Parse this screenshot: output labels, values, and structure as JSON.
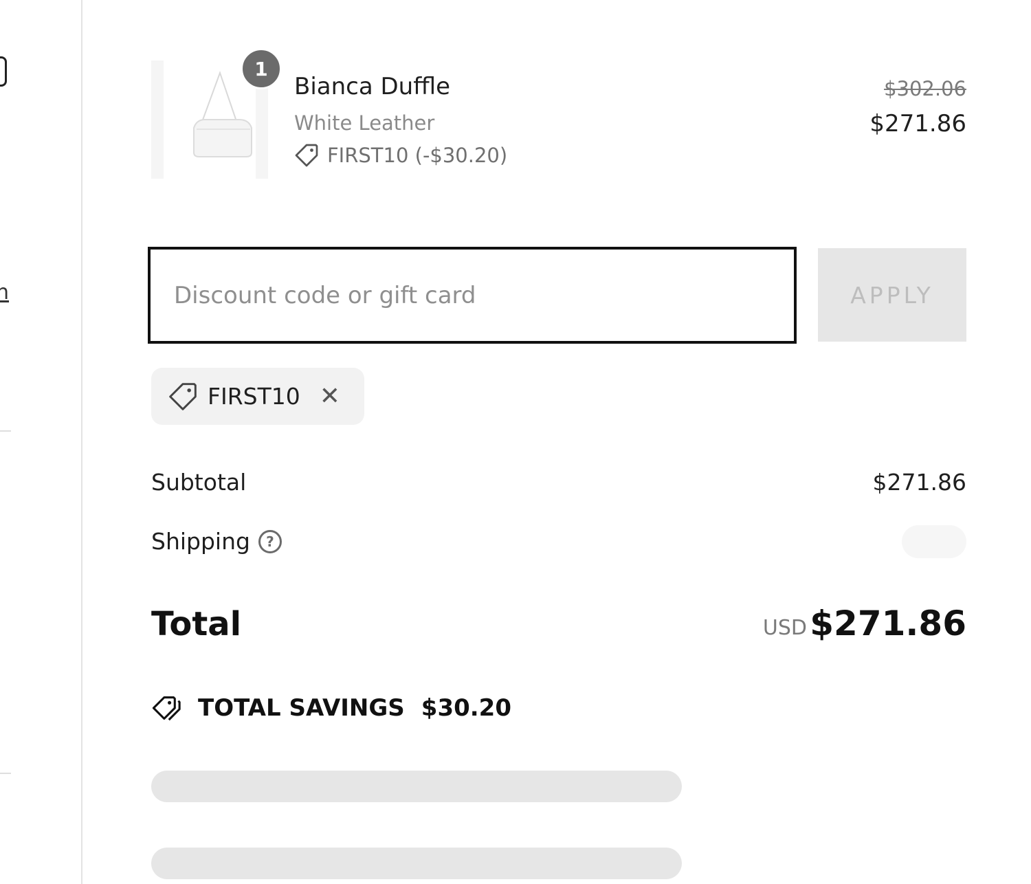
{
  "left_panel": {
    "link_fragment": "n"
  },
  "line_item": {
    "quantity": "1",
    "name": "Bianca Duffle",
    "variant": "White Leather",
    "discount_note": "FIRST10 (-$30.20)",
    "price_original": "$302.06",
    "price_current": "$271.86",
    "image_icon": "handbag-image"
  },
  "discount": {
    "placeholder": "Discount code or gift card",
    "apply_label": "APPLY"
  },
  "applied_code": {
    "label": "FIRST10",
    "remove_icon": "close-icon",
    "tag_icon": "tag-icon"
  },
  "summary": {
    "subtotal_label": "Subtotal",
    "subtotal_value": "$271.86",
    "shipping_label": "Shipping",
    "shipping_help_icon": "question-circle-icon",
    "total_label": "Total",
    "currency": "USD",
    "total_value": "$271.86"
  },
  "savings": {
    "label": "TOTAL SAVINGS",
    "amount": "$30.20",
    "icon": "tags-icon"
  },
  "colors": {
    "text_primary": "#1a1a1a",
    "text_muted": "#8a8a8a",
    "badge_bg": "#6b6b6b",
    "button_disabled_bg": "#e6e6e6",
    "chip_bg": "#f2f2f2",
    "skeleton": "#e6e6e6"
  }
}
